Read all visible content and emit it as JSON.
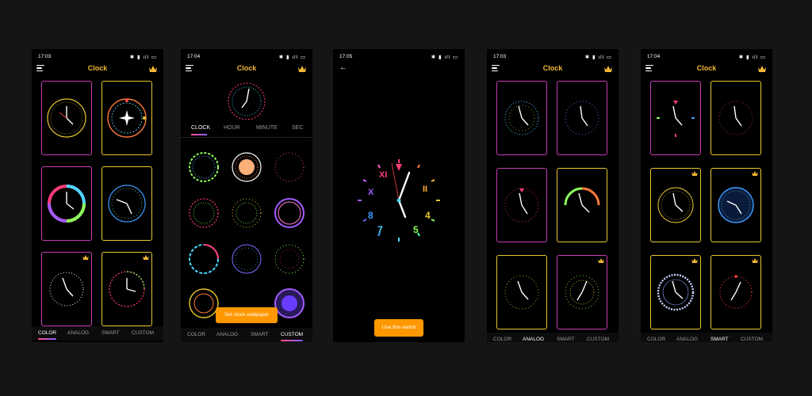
{
  "phones": [
    {
      "time": "17:03",
      "title": "Clock",
      "tabs": [
        "COLOR",
        "ANALOG",
        "SMART",
        "CUSTOM"
      ],
      "active_tab": "COLOR"
    },
    {
      "time": "17:04",
      "title": "Clock",
      "subtabs": [
        "CLOCK",
        "HOUR",
        "MINUTE",
        "SEC"
      ],
      "active_subtab": "CLOCK",
      "button": "Set clock wallpaper",
      "tabs": [
        "COLOR",
        "ANALOG",
        "SMART",
        "CUSTOM"
      ],
      "active_tab": "CUSTOM"
    },
    {
      "time": "17:05",
      "numerals": [
        "XI",
        "X",
        "II",
        "8",
        "4",
        "7",
        "5"
      ],
      "button": "Use this watch"
    },
    {
      "time": "17:03",
      "title": "Clock",
      "tabs": [
        "COLOR",
        "ANALOG",
        "SMART",
        "CUSTOM"
      ],
      "active_tab": "ANALOG"
    },
    {
      "time": "17:04",
      "title": "Clock",
      "tabs": [
        "COLOR",
        "ANALOG",
        "SMART",
        "CUSTOM"
      ],
      "active_tab": "SMART"
    }
  ],
  "icons": {
    "menu": "menu-icon",
    "crown": "crown-icon",
    "back": "back-arrow-icon"
  },
  "colors": {
    "accent": "#f2b735",
    "button": "#ff9800",
    "card_border_pink": "#c83cb4",
    "card_border_yellow": "#e8c830"
  }
}
